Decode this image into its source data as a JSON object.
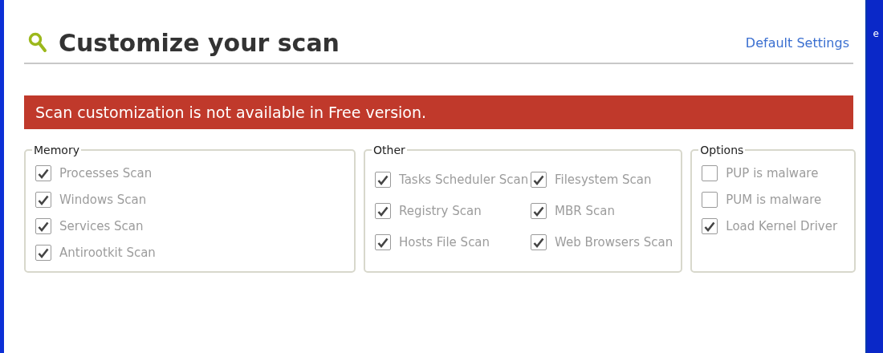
{
  "header": {
    "title": "Customize your scan",
    "link": "Default Settings"
  },
  "banner": {
    "text": "Scan customization is not available in Free version."
  },
  "groups": [
    {
      "kind": "list",
      "legend": "Memory",
      "items": [
        {
          "label": "Processes Scan",
          "checked": true,
          "disabled": true
        },
        {
          "label": "Windows Scan",
          "checked": true,
          "disabled": true
        },
        {
          "label": "Services Scan",
          "checked": true,
          "disabled": true
        },
        {
          "label": "Antirootkit Scan",
          "checked": true,
          "disabled": true
        }
      ]
    },
    {
      "kind": "grid",
      "legend": "Other",
      "items": [
        {
          "label": "Tasks Scheduler Scan",
          "checked": true,
          "disabled": true
        },
        {
          "label": "Filesystem Scan",
          "checked": true,
          "disabled": true
        },
        {
          "label": "Registry Scan",
          "checked": true,
          "disabled": true
        },
        {
          "label": "MBR Scan",
          "checked": true,
          "disabled": true
        },
        {
          "label": "Hosts File Scan",
          "checked": true,
          "disabled": true
        },
        {
          "label": "Web Browsers Scan",
          "checked": true,
          "disabled": true
        }
      ]
    },
    {
      "kind": "list",
      "legend": "Options",
      "items": [
        {
          "label": "PUP is malware",
          "checked": false,
          "disabled": true
        },
        {
          "label": "PUM is malware",
          "checked": false,
          "disabled": true
        },
        {
          "label": "Load Kernel Driver",
          "checked": true,
          "disabled": true
        }
      ]
    }
  ],
  "side_window": {
    "text": "e"
  }
}
